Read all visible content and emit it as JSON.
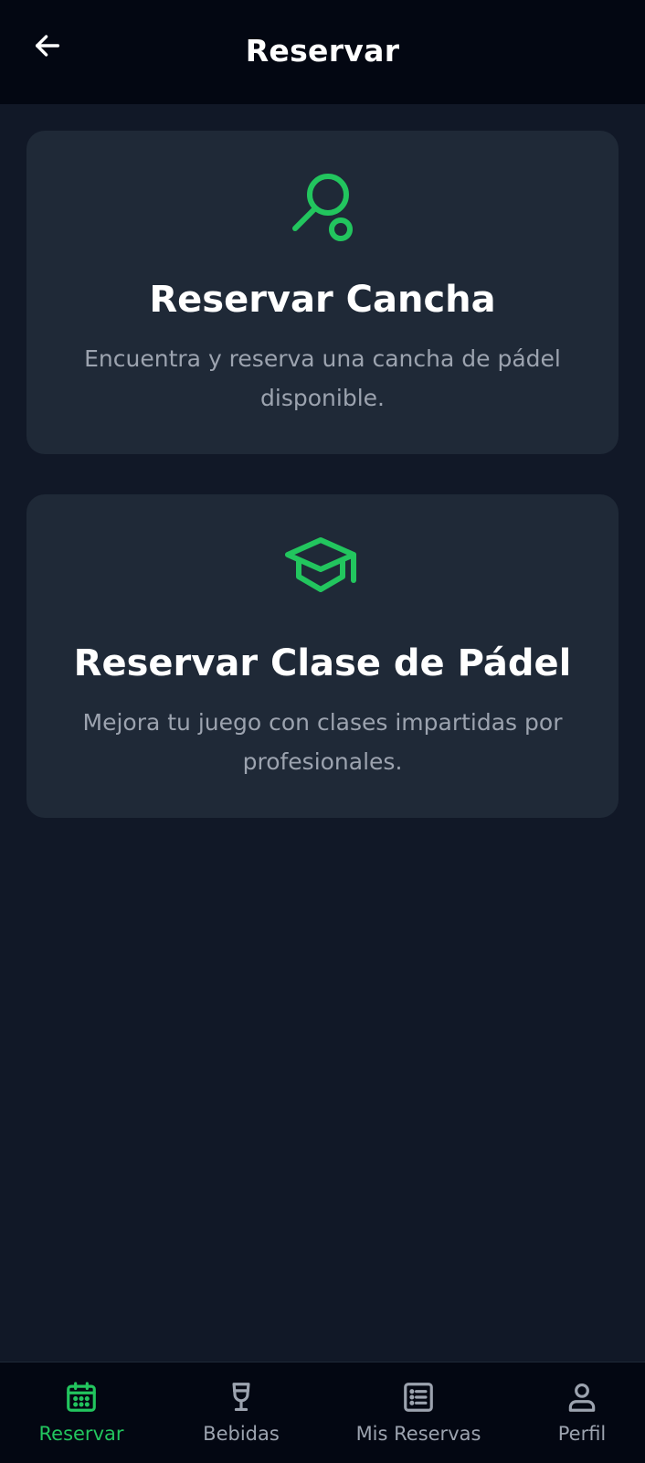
{
  "app_bar": {
    "title": "Reservar",
    "back_icon": "arrow-left-icon"
  },
  "cards": [
    {
      "icon": "padel-racket-icon",
      "title": "Reservar Cancha",
      "description": "Encuentra y reserva una cancha de pádel disponible."
    },
    {
      "icon": "graduation-cap-icon",
      "title": "Reservar Clase de Pádel",
      "description": "Mejora tu juego con clases impartidas por profesionales."
    }
  ],
  "bottom_nav": {
    "items": [
      {
        "label": "Reservar",
        "icon": "calendar-icon",
        "active": true
      },
      {
        "label": "Bebidas",
        "icon": "wine-glass-icon",
        "active": false
      },
      {
        "label": "Mis Reservas",
        "icon": "list-icon",
        "active": false
      },
      {
        "label": "Perfil",
        "icon": "user-icon",
        "active": false
      }
    ]
  },
  "colors": {
    "background": "#111827",
    "app_bar": "#030712",
    "card": "#1f2937",
    "accent": "#22c55e",
    "muted_text": "#9ca3af",
    "text": "#ffffff"
  }
}
